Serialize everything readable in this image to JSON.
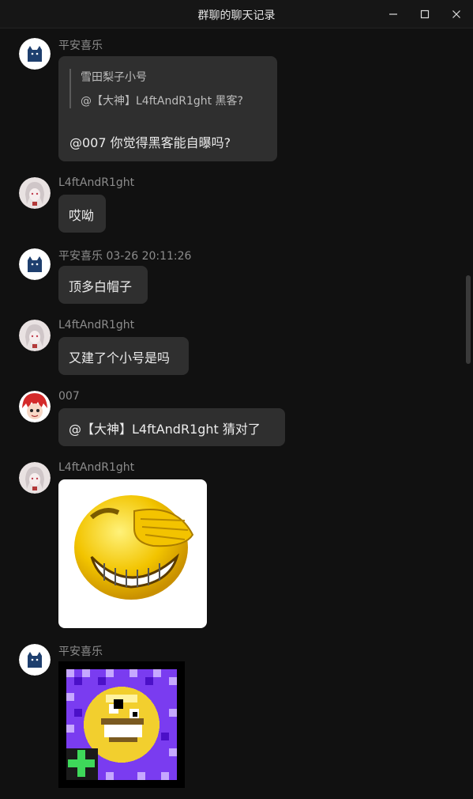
{
  "window": {
    "title": "群聊的聊天记录",
    "minimize_icon": "minimize-icon",
    "maximize_icon": "maximize-icon",
    "close_icon": "close-icon"
  },
  "messages": [
    {
      "sender": "平安喜乐",
      "avatar": "cat-avatar",
      "quote": {
        "author": "雪田梨子小号",
        "text": "@【大神】L4ftAndR1ght 黑客?"
      },
      "text": "@007 你觉得黑客能自曝吗?"
    },
    {
      "sender": "L4ftAndR1ght",
      "avatar": "anime-girl-avatar",
      "text": "哎呦"
    },
    {
      "sender": "平安喜乐",
      "time": "03-26 20:11:26",
      "avatar": "cat-avatar",
      "text": "顶多白帽子"
    },
    {
      "sender": "L4ftAndR1ght",
      "avatar": "anime-girl-avatar",
      "text": "又建了个小号是吗"
    },
    {
      "sender": "007",
      "avatar": "red-hair-avatar",
      "text": "@【大神】L4ftAndR1ght 猜对了"
    },
    {
      "sender": "L4ftAndR1ght",
      "avatar": "anime-girl-avatar",
      "sticker": "laughing-face-sticker"
    },
    {
      "sender": "平安喜乐",
      "avatar": "cat-avatar",
      "sticker": "pixel-smiley-sticker"
    }
  ],
  "colors": {
    "background": "#111111",
    "bubble": "#2f2f2f",
    "sender_text": "#8c8c8c",
    "message_text": "#ececec"
  }
}
